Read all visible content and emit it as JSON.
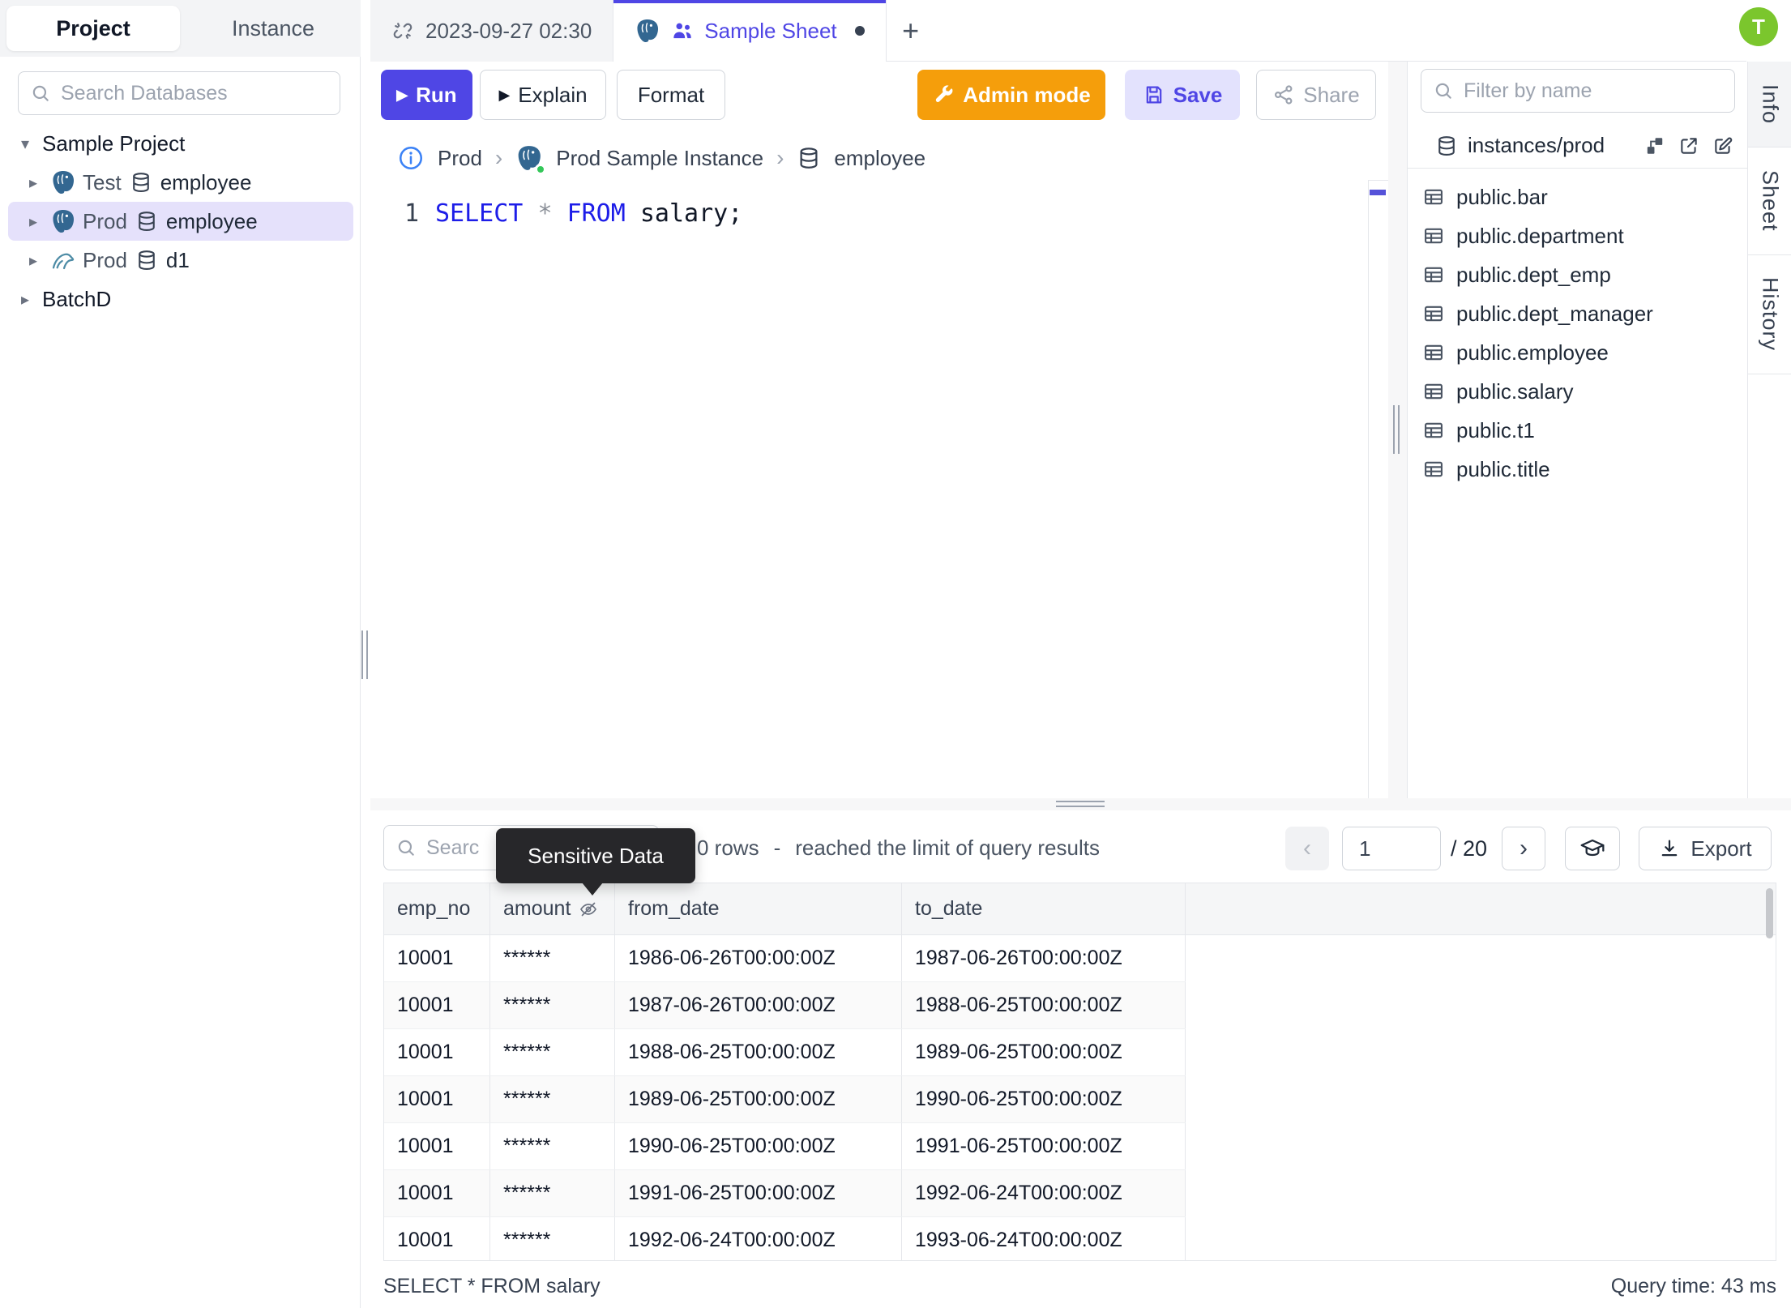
{
  "colors": {
    "accent_indigo": "#4f46e5",
    "admin_amber": "#f59e0b",
    "avatar_green": "#7bc62d",
    "keyword_blue": "#1d1de8",
    "selected_row": "#e5e1fb",
    "tooltip_bg": "#27272a",
    "status_green": "#34c759"
  },
  "glyphs": {
    "caret_down": "▾",
    "caret_right": "▸",
    "chevron_sep": "›",
    "plus": "+",
    "play": "▶",
    "dash": "-",
    "prev": "‹",
    "next": "›"
  },
  "icons": {
    "search": "magnifier",
    "unlink": "broken-chain",
    "postgres": "elephant",
    "mysql": "dolphin",
    "database": "cylinder",
    "table": "grid",
    "people": "shared-group",
    "info": "info-circle",
    "wrench": "wrench",
    "save": "floppy-disk",
    "share": "share-nodes",
    "diagram": "schema-diagram",
    "external": "external-link",
    "edit": "pencil-square",
    "eye_off": "eye-slash",
    "graduation": "graduation-cap",
    "download": "download-arrow"
  },
  "sidebar": {
    "tab_project": "Project",
    "tab_instance": "Instance",
    "search_placeholder": "Search Databases",
    "project_label": "Sample Project",
    "items": [
      {
        "env": "Test",
        "db": "employee",
        "engine": "postgres"
      },
      {
        "env": "Prod",
        "db": "employee",
        "engine": "postgres",
        "selected": true
      },
      {
        "env": "Prod",
        "db": "d1",
        "engine": "mysql"
      }
    ],
    "batch_label": "BatchD"
  },
  "tabbar": {
    "tab1_label": "2023-09-27 02:30",
    "tab2_label": "Sample Sheet",
    "new_tab_label": "+"
  },
  "avatar_initial": "T",
  "toolbar": {
    "run_label": "Run",
    "explain_label": "Explain",
    "format_label": "Format",
    "admin_label": "Admin mode",
    "save_label": "Save",
    "share_label": "Share"
  },
  "breadcrumb": {
    "env": "Prod",
    "instance": "Prod Sample Instance",
    "database": "employee"
  },
  "editor": {
    "line_number": "1",
    "kw_select": "SELECT",
    "star": "*",
    "kw_from": "FROM",
    "rest": "salary;"
  },
  "right_panel": {
    "filter_placeholder": "Filter by name",
    "instance_path": "instances/prod",
    "tables": [
      "public.bar",
      "public.department",
      "public.dept_emp",
      "public.dept_manager",
      "public.employee",
      "public.salary",
      "public.t1",
      "public.title"
    ]
  },
  "side_tabs": {
    "info": "Info",
    "sheet": "Sheet",
    "history": "History"
  },
  "results": {
    "search_placeholder": "Searc",
    "tooltip_text": "Sensitive Data",
    "rows_count": "0 rows",
    "rows_dash": "-",
    "rows_limit": "reached the limit of query results",
    "page_value": "1",
    "page_total": "/ 20",
    "export_label": "Export",
    "columns": [
      "emp_no",
      "amount",
      "from_date",
      "to_date"
    ],
    "masked_column": "amount",
    "rows": [
      [
        "10001",
        "******",
        "1986-06-26T00:00:00Z",
        "1987-06-26T00:00:00Z"
      ],
      [
        "10001",
        "******",
        "1987-06-26T00:00:00Z",
        "1988-06-25T00:00:00Z"
      ],
      [
        "10001",
        "******",
        "1988-06-25T00:00:00Z",
        "1989-06-25T00:00:00Z"
      ],
      [
        "10001",
        "******",
        "1989-06-25T00:00:00Z",
        "1990-06-25T00:00:00Z"
      ],
      [
        "10001",
        "******",
        "1990-06-25T00:00:00Z",
        "1991-06-25T00:00:00Z"
      ],
      [
        "10001",
        "******",
        "1991-06-25T00:00:00Z",
        "1992-06-24T00:00:00Z"
      ],
      [
        "10001",
        "******",
        "1992-06-24T00:00:00Z",
        "1993-06-24T00:00:00Z"
      ]
    ],
    "status_left": "SELECT * FROM salary",
    "status_right": "Query time: 43 ms"
  }
}
